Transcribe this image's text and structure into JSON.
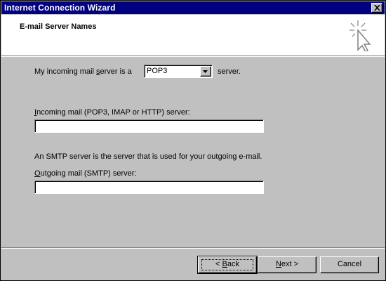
{
  "window": {
    "title": "Internet Connection Wizard",
    "close_icon": "close-icon"
  },
  "header": {
    "title": "E-mail Server Names",
    "icon": "wizard-sparkle-cursor-icon"
  },
  "incoming_server_type": {
    "prefix_first": "My incoming mail ",
    "prefix_mnemonic": "s",
    "prefix_rest": "erver is a",
    "value": "POP3",
    "suffix": "server."
  },
  "incoming_server": {
    "label_mnemonic": "I",
    "label_rest": "ncoming mail (POP3, IMAP or HTTP) server:",
    "value": ""
  },
  "smtp_note": "An SMTP server is the server that is used for your outgoing e-mail.",
  "outgoing_server": {
    "label_mnemonic": "O",
    "label_rest": "utgoing mail (SMTP) server:",
    "value": ""
  },
  "buttons": {
    "back_prefix": "< ",
    "back_mnemonic": "B",
    "back_rest": "ack",
    "next_mnemonic": "N",
    "next_rest": "ext >",
    "cancel": "Cancel"
  }
}
